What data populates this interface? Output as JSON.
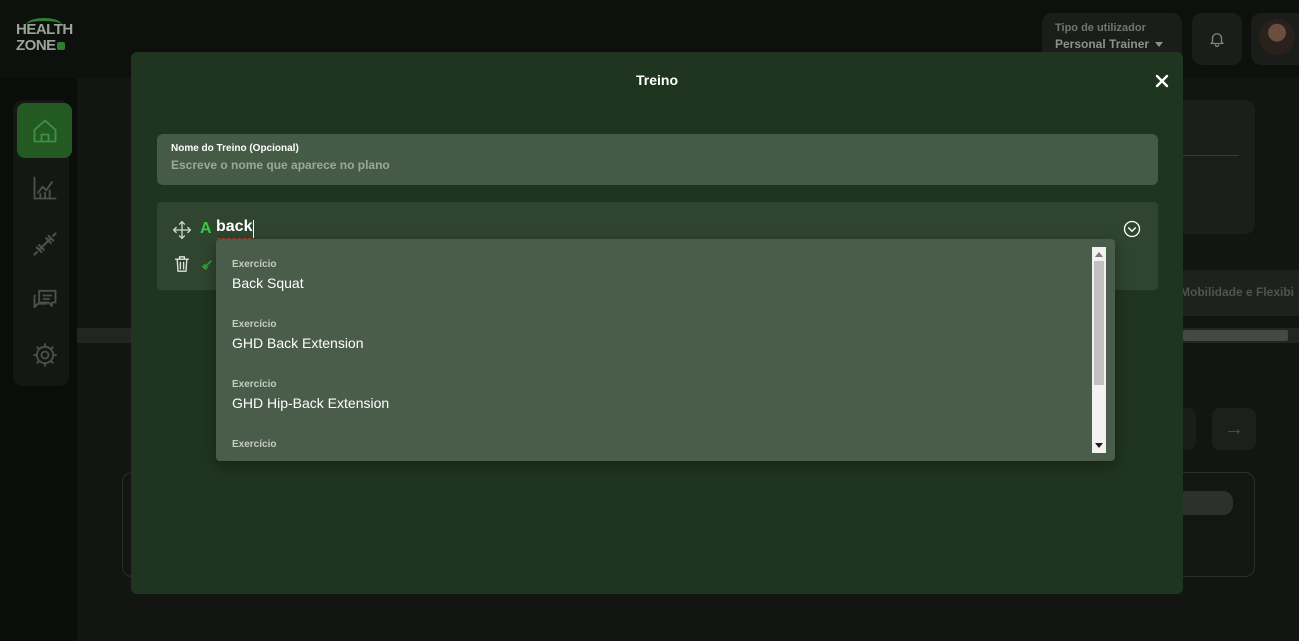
{
  "app": {
    "logo_line1": "HEALTH",
    "logo_line2": "ZONE",
    "user_type_label": "Tipo de utilizador",
    "user_type_value": "Personal Trainer"
  },
  "background": {
    "chip_text": "Mobilidade e Flexibi",
    "arrow": "→"
  },
  "sidebar": {
    "items": [
      {
        "icon": "home-icon",
        "active": true
      },
      {
        "icon": "chart-icon",
        "active": false
      },
      {
        "icon": "dumbbell-icon",
        "active": false
      },
      {
        "icon": "messages-icon",
        "active": false
      },
      {
        "icon": "settings-icon",
        "active": false
      }
    ]
  },
  "modal": {
    "title": "Treino",
    "name_field": {
      "label": "Nome do Treino (Opcional)",
      "placeholder": "Escreve o nome que aparece no plano",
      "value": ""
    },
    "exercise": {
      "prefix": "A",
      "query": "back"
    },
    "dropdown": {
      "items": [
        {
          "label": "Exercício",
          "name": "Back Squat"
        },
        {
          "label": "Exercício",
          "name": "GHD Back Extension"
        },
        {
          "label": "Exercício",
          "name": "GHD Hip-Back Extension"
        },
        {
          "label": "Exercício",
          "name": ""
        }
      ]
    }
  },
  "colors": {
    "accent_green": "#39c83e",
    "modal_bg": "#1f351f",
    "field_bg": "#465b46",
    "dropdown_bg": "#4a5d4a",
    "active_nav": "#225a22"
  }
}
